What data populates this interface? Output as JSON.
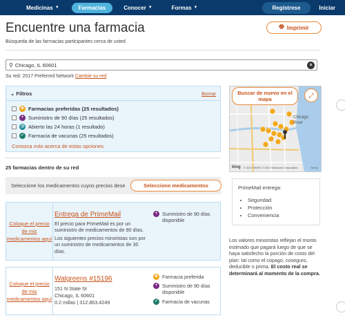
{
  "nav": {
    "items": [
      {
        "label": "Medicinas"
      },
      {
        "label": "Farmacias"
      },
      {
        "label": "Conocer"
      },
      {
        "label": "Formas"
      }
    ],
    "register": "Regístrese",
    "signin": "Iniciar"
  },
  "page": {
    "title": "Encuentre una farmacia",
    "subtitle": "Búsqueda de las farmacias participantes cerca de usted",
    "print": "Imprimir"
  },
  "search": {
    "value": "Chicago, IL 60601"
  },
  "network": {
    "text": "Su red: 2017 Preferred Network",
    "change": "Cambie su red"
  },
  "filters": {
    "title": "Filtros",
    "clear": "Borrar",
    "options": [
      {
        "label": "Farmacias preferidas (25 resultados)",
        "bold": true
      },
      {
        "label": "Suministro de 90 días (25 resultados)"
      },
      {
        "label": "Abierto las 24 horas (1 resultado)"
      },
      {
        "label": "Farmacia de vacunas (25 resultados)"
      }
    ],
    "more": "Conozca más acerca de estas opciones"
  },
  "results": {
    "count": "25 farmacias dentro de su red"
  },
  "meds": {
    "text": "Seleccione los medicamentos cuyos precios dese",
    "button": "Seleccione medicamentos"
  },
  "cards": [
    {
      "left": "Coloque el precio de mis medicamentos aquí",
      "name": "Entrega de PrimeMail",
      "desc1": "El precio para PrimeMail es por un suministro de medicamentos de 90 días.",
      "desc2": "Los siguientes precios minoristas son por un suministro de medicamentos de 30 días.",
      "tags": [
        "Suministro de 90 días disponible"
      ]
    },
    {
      "left": "Coloque el precio de mis medicamentos aquí",
      "name": "Walgreens #15196",
      "address1": "151 N State St",
      "address2": "Chicago, IL 60601",
      "address3": "0.2 millas | 312.863.4249",
      "tags": [
        "Farmacia preferida",
        "Suministro de 90 días disponible",
        "Farmacia de vacunas"
      ]
    }
  ],
  "map": {
    "search_again": "Buscar de nuevo en el mapa",
    "label_chicago": "Chicago",
    "label_river": "River",
    "copyright": "© 2017 HERE © 2017 Microsoft Corporation",
    "terms": "Terms",
    "brand": "bing"
  },
  "primemail": {
    "title": "PrimeMail entrega:",
    "items": [
      "Seguridad",
      "Protección",
      "Conveniencia"
    ]
  },
  "disclaimer": {
    "text": "Los valores minoristas reflejan el monto estimado que pagará luego de que se haya satisfecho la porción de costo del plan: tal como el copago, coseguro, deducible o prima.",
    "bold": "El costo real se determinará al momento de la compra."
  },
  "colors": {
    "nav": "#0a3a6b",
    "accent": "#c8521a",
    "active_tab": "#4fb3dc",
    "panel": "#e9f4fb"
  }
}
